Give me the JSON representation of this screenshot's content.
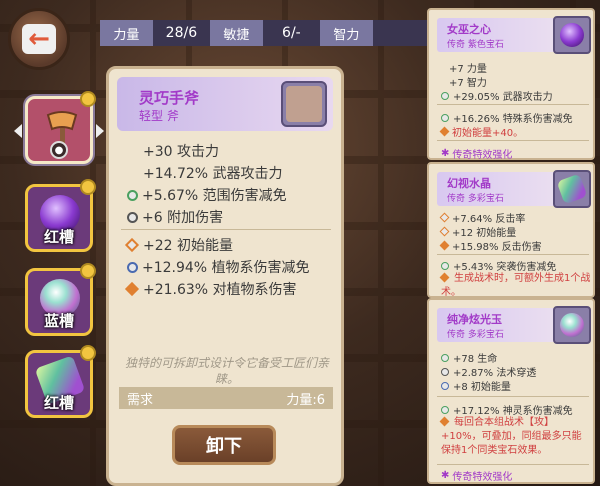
{
  "back_button": {
    "icon": "back-arrow-icon"
  },
  "stats": [
    {
      "label": "力量",
      "value": "28/6"
    },
    {
      "label": "敏捷",
      "value": "6/-"
    },
    {
      "label": "智力",
      "value": ""
    }
  ],
  "slots": [
    {
      "label": "",
      "icon": "axe-icon",
      "locked": true
    },
    {
      "label": "红槽",
      "icon": "purple-gem-icon"
    },
    {
      "label": "蓝槽",
      "icon": "rainbow-gem-icon"
    },
    {
      "label": "红槽",
      "icon": "crystal-gem-icon"
    }
  ],
  "item": {
    "name": "灵巧手斧",
    "type": "轻型 斧",
    "base_stats": [
      "+30 攻击力",
      "+14.72% 武器攻击力"
    ],
    "stats_2": [
      "+5.67% 范围伤害减免",
      "+6 附加伤害"
    ],
    "stats_3": [
      "+22 初始能量",
      "+12.94% 植物系伤害减免",
      "+21.63% 对植物系伤害"
    ],
    "flavor": "独特的可拆卸式设计令它备受工匠们亲睐。",
    "requirement_label": "需求",
    "requirement_value": "力量:6",
    "unequip_label": "卸下"
  },
  "gem_cards": [
    {
      "name": "女巫之心",
      "type": "传奇 紫色宝石",
      "lines": [
        "+7 力量",
        "+7 智力",
        "+29.05% 武器攻击力"
      ],
      "lines2": [
        "+16.26% 特殊系伤害减免",
        "初始能量+40。"
      ],
      "footer": "传奇特效强化"
    },
    {
      "name": "幻视水晶",
      "type": "传奇 多彩宝石",
      "lines": [
        "+7.64% 反击率",
        "+12 初始能量",
        "+15.98% 反击伤害"
      ],
      "lines2": [
        "+5.43% 突袭伤害减免",
        "生成战术时，可额外生成1个战术。"
      ]
    },
    {
      "name": "纯净炫光玉",
      "type": "传奇 多彩宝石",
      "lines": [
        "+78 生命",
        "+2.87% 法术穿透",
        "+8 初始能量"
      ],
      "lines2": [
        "+17.12% 神灵系伤害减免",
        "每回合本组战术【攻】+10%，可叠加，同组最多只能保持1个同类宝石效果。"
      ],
      "footer": "传奇特效强化"
    }
  ],
  "colors": {
    "accent": "#a23ac8",
    "card_bg": "#efe4cf",
    "slot_border": "#f2c540"
  }
}
